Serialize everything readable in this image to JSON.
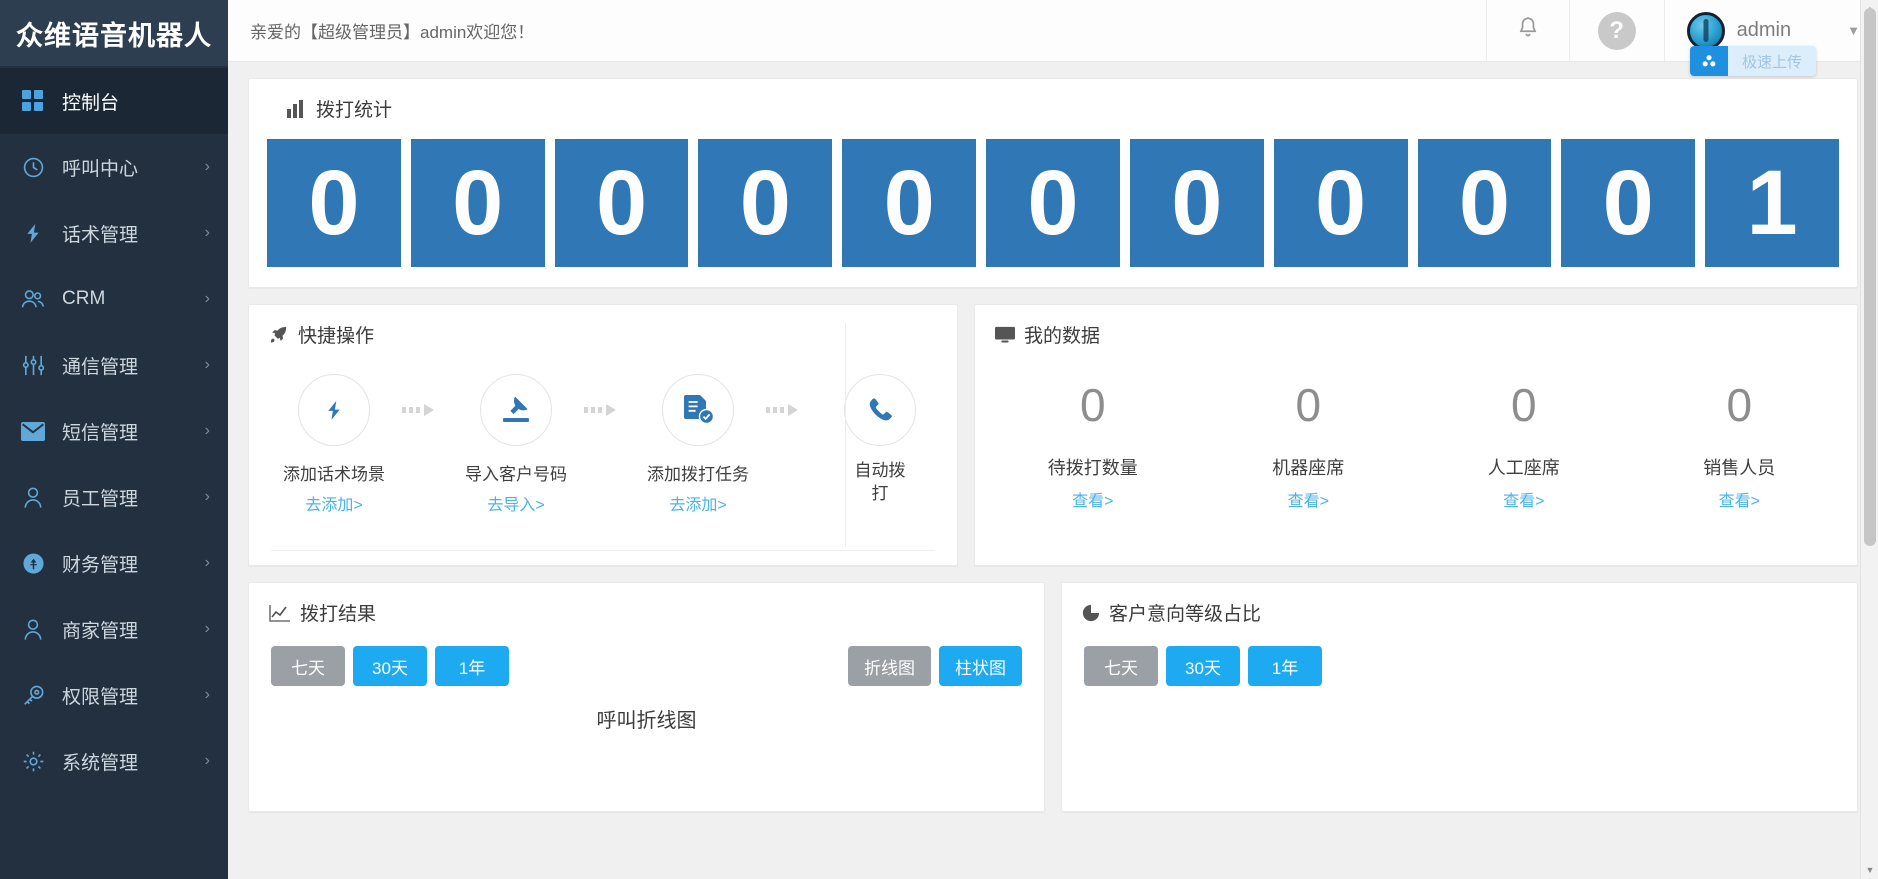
{
  "sidebar": {
    "logo": "众维语音机器人",
    "items": [
      {
        "label": "控制台",
        "icon": "dashboard-icon",
        "active": true,
        "arrow": ""
      },
      {
        "label": "呼叫中心",
        "icon": "clock-icon",
        "active": false,
        "arrow": "›"
      },
      {
        "label": "话术管理",
        "icon": "lightning-icon",
        "active": false,
        "arrow": "›"
      },
      {
        "label": "CRM",
        "icon": "users-icon",
        "active": false,
        "arrow": "›"
      },
      {
        "label": "通信管理",
        "icon": "sliders-icon",
        "active": false,
        "arrow": "›"
      },
      {
        "label": "短信管理",
        "icon": "envelope-icon",
        "active": false,
        "arrow": "›"
      },
      {
        "label": "员工管理",
        "icon": "user-icon",
        "active": false,
        "arrow": "›"
      },
      {
        "label": "财务管理",
        "icon": "money-icon",
        "active": false,
        "arrow": "›"
      },
      {
        "label": "商家管理",
        "icon": "user-icon",
        "active": false,
        "arrow": "›"
      },
      {
        "label": "权限管理",
        "icon": "key-icon",
        "active": false,
        "arrow": "›"
      },
      {
        "label": "系统管理",
        "icon": "gear-icon",
        "active": false,
        "arrow": "›"
      }
    ]
  },
  "topbar": {
    "welcome": "亲爱的【超级管理员】admin欢迎您！",
    "bell_icon": "bell-icon",
    "help_icon": "question-mark-icon",
    "avatar_icon": "avatar",
    "user_name": "admin",
    "caret": "▼",
    "extension_badge": {
      "icon": "cloud-upload-icon",
      "label": "极速上传"
    }
  },
  "stats": {
    "title": "拨打统计",
    "title_icon": "bar-chart-icon",
    "digits": [
      "0",
      "0",
      "0",
      "0",
      "0",
      "0",
      "0",
      "0",
      "0",
      "0",
      "1"
    ],
    "digit_color": "#2f77b5"
  },
  "quick": {
    "title": "快捷操作",
    "title_icon": "rocket-icon",
    "steps": [
      {
        "icon": "lightning-icon",
        "name": "添加话术场景",
        "link": "去添加>"
      },
      {
        "icon": "import-icon",
        "name": "导入客户号码",
        "link": "去导入>"
      },
      {
        "icon": "task-doc-icon",
        "name": "添加拨打任务",
        "link": "去添加>"
      },
      {
        "icon": "phone-icon",
        "name": "自动拨打",
        "link": ""
      }
    ],
    "arrow": "⇢"
  },
  "mydata": {
    "title": "我的数据",
    "title_icon": "monitor-icon",
    "cells": [
      {
        "value": "0",
        "label": "待拨打数量",
        "link": "查看>"
      },
      {
        "value": "0",
        "label": "机器座席",
        "link": "查看>"
      },
      {
        "value": "0",
        "label": "人工座席",
        "link": "查看>"
      },
      {
        "value": "0",
        "label": "销售人员",
        "link": "查看>"
      }
    ]
  },
  "call_result": {
    "title": "拨打结果",
    "title_icon": "line-chart-icon",
    "range_buttons": [
      {
        "label": "七天",
        "active": true
      },
      {
        "label": "30天",
        "active": false
      },
      {
        "label": "1年",
        "active": false
      }
    ],
    "type_buttons": [
      {
        "label": "折线图",
        "active": true
      },
      {
        "label": "柱状图",
        "active": false
      }
    ],
    "caption": "呼叫折线图"
  },
  "intent_ratio": {
    "title": "客户意向等级占比",
    "title_icon": "pie-chart-icon",
    "range_buttons": [
      {
        "label": "七天",
        "active": true
      },
      {
        "label": "30天",
        "active": false
      },
      {
        "label": "1年",
        "active": false
      }
    ]
  },
  "colors": {
    "sidebar_bg": "#22303f",
    "logo_bg": "#2c3e50",
    "accent_blue": "#1eaaf1",
    "digit_blue": "#2f77b5",
    "link_blue": "#4bb3e8",
    "gray_button": "#9aa0a6",
    "page_bg": "#f0f0f0"
  },
  "scrollbar": {
    "up": "▲",
    "down": "▼"
  }
}
